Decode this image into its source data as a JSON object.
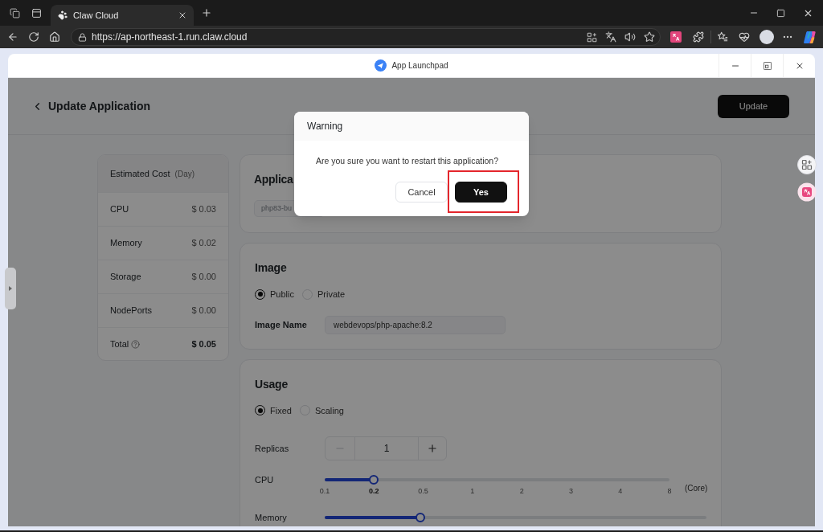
{
  "browser": {
    "tab": {
      "title": "Claw Cloud"
    },
    "url": "https://ap-northeast-1.run.claw.cloud"
  },
  "app_window": {
    "title": "App Launchpad"
  },
  "header": {
    "title": "Update Application",
    "button": "Update"
  },
  "cost": {
    "title": "Estimated Cost",
    "period": "(Day)",
    "rows": [
      {
        "label": "CPU",
        "value": "$ 0.03"
      },
      {
        "label": "Memory",
        "value": "$ 0.02"
      },
      {
        "label": "Storage",
        "value": "$ 0.00"
      },
      {
        "label": "NodePorts",
        "value": "$ 0.00"
      }
    ],
    "total": {
      "label": "Total",
      "value": "$ 0.05"
    }
  },
  "name_section": {
    "title": "Applica",
    "value": "php83-bu",
    "disabled": true
  },
  "image_section": {
    "title": "Image",
    "options": [
      {
        "label": "Public",
        "selected": true
      },
      {
        "label": "Private",
        "selected": false
      }
    ],
    "field_label": "Image Name",
    "field_value": "webdevops/php-apache:8.2"
  },
  "usage_section": {
    "title": "Usage",
    "options": [
      {
        "label": "Fixed",
        "selected": true
      },
      {
        "label": "Scaling",
        "selected": false
      }
    ],
    "replicas": {
      "label": "Replicas",
      "value": "1",
      "decrement_disabled": true
    },
    "sliders": [
      {
        "label": "CPU",
        "level": 0.143,
        "ticks": [
          {
            "label": "0.1",
            "selected": false
          },
          {
            "label": "0.2",
            "selected": true
          },
          {
            "label": "0.5",
            "selected": false
          },
          {
            "label": "1",
            "selected": false
          },
          {
            "label": "2",
            "selected": false
          },
          {
            "label": "3",
            "selected": false
          },
          {
            "label": "4",
            "selected": false
          },
          {
            "label": "8",
            "selected": false
          }
        ],
        "unit": "(Core)"
      },
      {
        "label": "Memory",
        "level": 0.25
      }
    ]
  },
  "dialog": {
    "title": "Warning",
    "message": "Are you sure you want to restart this application?",
    "buttons": [
      {
        "label": "Cancel",
        "kind": "secondary"
      },
      {
        "label": "Yes",
        "kind": "primary",
        "highlighted": true
      }
    ]
  }
}
